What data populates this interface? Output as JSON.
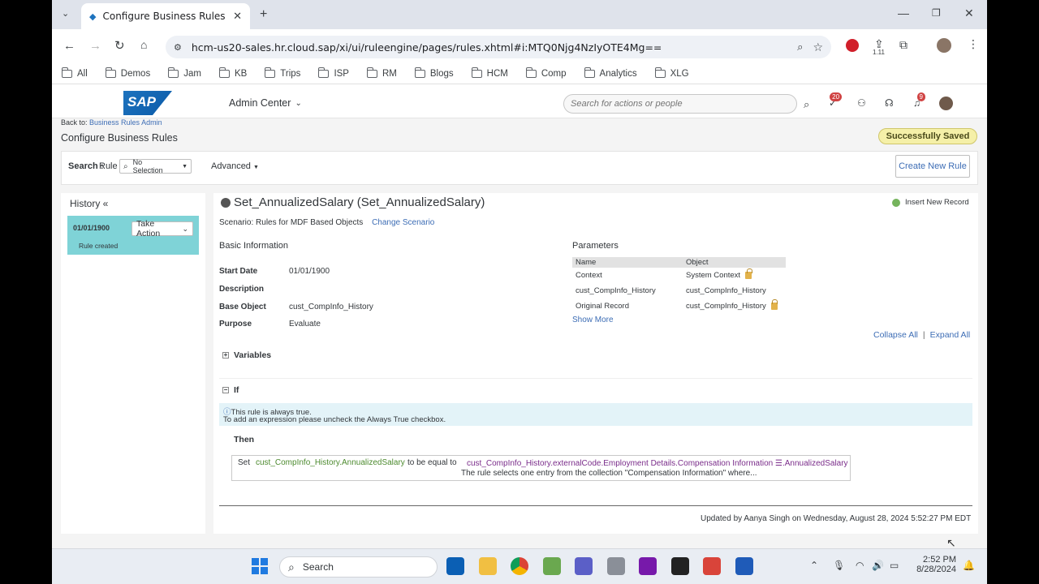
{
  "browser": {
    "tab_title": "Configure Business Rules - Suc",
    "url": "hcm-us20-sales.hr.cloud.sap/xi/ui/ruleengine/pages/rules.xhtml#i:MTQ0Njg4NzIyOTE4Mg==",
    "extensions_badge": "1.11",
    "bookmarks": [
      {
        "label": "All"
      },
      {
        "label": "Demos"
      },
      {
        "label": "Jam"
      },
      {
        "label": "KB"
      },
      {
        "label": "Trips"
      },
      {
        "label": "ISP"
      },
      {
        "label": "RM"
      },
      {
        "label": "Blogs"
      },
      {
        "label": "HCM"
      },
      {
        "label": "Comp"
      },
      {
        "label": "Analytics"
      },
      {
        "label": "XLG"
      }
    ]
  },
  "shell": {
    "logo_text": "SAP",
    "module": "Admin Center",
    "search_placeholder": "Search for actions or people",
    "todo_count": "20",
    "notifications_count": "9"
  },
  "page": {
    "back_prefix": "Back to:",
    "back_link": "Business Rules Admin",
    "title": "Configure Business Rules",
    "status_badge": "Successfully Saved",
    "search_label": "Search :",
    "search_type": "Rule",
    "search_select": "No Selection",
    "advanced": "Advanced",
    "create_button": "Create New Rule"
  },
  "history": {
    "title": "History «",
    "entry_date": "01/01/1900",
    "take_action": "Take Action",
    "entry_note": "Rule created"
  },
  "rule": {
    "name": "Set_AnnualizedSalary (Set_AnnualizedSalary)",
    "insert_record": "Insert New Record",
    "scenario_label": "Scenario:",
    "scenario_value": "Rules for MDF Based Objects",
    "change_scenario": "Change Scenario",
    "basic_info_title": "Basic Information",
    "fields": [
      {
        "label": "Start Date",
        "value": "01/01/1900"
      },
      {
        "label": "Description",
        "value": ""
      },
      {
        "label": "Base Object",
        "value": "cust_CompInfo_History"
      },
      {
        "label": "Purpose",
        "value": "Evaluate"
      }
    ],
    "params_title": "Parameters",
    "params_headers": {
      "name": "Name",
      "object": "Object"
    },
    "params": [
      {
        "name": "Context",
        "object": "System Context"
      },
      {
        "name": "cust_CompInfo_History",
        "object": "cust_CompInfo_History"
      },
      {
        "name": "Original Record",
        "object": "cust_CompInfo_History"
      }
    ],
    "show_more": "Show More",
    "collapse_all": "Collapse All",
    "expand_all": "Expand All",
    "variables": "Variables",
    "if_label": "If",
    "always_true_line1": "This rule is always true.",
    "always_true_line2": "To add an expression please uncheck the Always True checkbox.",
    "then_label": "Then",
    "set_label": "Set",
    "set_target": "cust_CompInfo_History.AnnualizedSalary",
    "equal_label": "to be equal to",
    "set_source": "cust_CompInfo_History.externalCode.Employment Details.Compensation Information ☰.AnnualizedSalary",
    "collection_note": "The rule selects one entry from the collection \"Compensation Information\" where...",
    "updated_by": "Updated by Aanya Singh on Wednesday, August 28, 2024 5:52:27 PM EDT"
  },
  "taskbar": {
    "search": "Search",
    "time": "2:52 PM",
    "date": "8/28/2024"
  },
  "colors": {
    "accent": "#3d6db5",
    "history_bg": "#7fd3d7",
    "success_bg": "#f5f0a8"
  }
}
